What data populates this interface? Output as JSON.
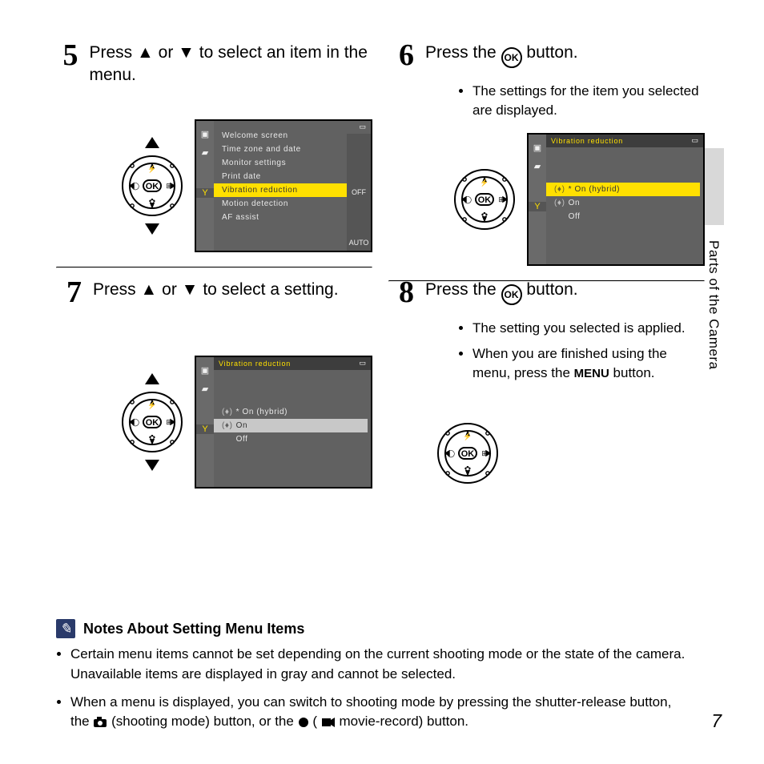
{
  "sidebar_text": "Parts of the Camera",
  "page_number": "7",
  "steps": {
    "s5": {
      "num": "5",
      "text_a": "Press ",
      "text_b": " or ",
      "text_c": " to select an item in the menu."
    },
    "s6": {
      "num": "6",
      "text_a": "Press the ",
      "text_b": " button.",
      "bullets": [
        "The settings for the item you selected are displayed."
      ]
    },
    "s7": {
      "num": "7",
      "text_a": "Press ",
      "text_b": " or ",
      "text_c": " to select a setting."
    },
    "s8": {
      "num": "8",
      "text_a": "Press the ",
      "text_b": " button.",
      "bullets": [
        "The setting you selected is applied.",
        "When you are finished using the menu, press the "
      ],
      "bullet2_tail": " button."
    }
  },
  "menu_word": "MENU",
  "ok_label": "OK",
  "lcd_setup": {
    "items": [
      "Welcome screen",
      "Time zone and date",
      "Monitor settings",
      "Print date",
      "Vibration reduction",
      "Motion detection",
      "AF assist"
    ],
    "highlight": 4,
    "right_values": [
      "",
      "",
      "",
      "OFF",
      "",
      "",
      "AUTO"
    ]
  },
  "lcd_vr": {
    "title": "Vibration reduction",
    "items": [
      "On (hybrid)",
      "On",
      "Off"
    ]
  },
  "lcd_vr_step6_highlight": 0,
  "lcd_vr_step7_highlight": 1,
  "notes": {
    "heading": "Notes About Setting Menu Items",
    "items": [
      "Certain menu items cannot be set depending on the current shooting mode or the state of the camera. Unavailable items are displayed in gray and cannot be selected.",
      "When a menu is displayed, you can switch to shooting mode by pressing the shutter-release button, the "
    ],
    "item2_mid": " (shooting mode) button, or the ",
    "item2_mid2": " (",
    "item2_tail": " movie-record) button."
  }
}
